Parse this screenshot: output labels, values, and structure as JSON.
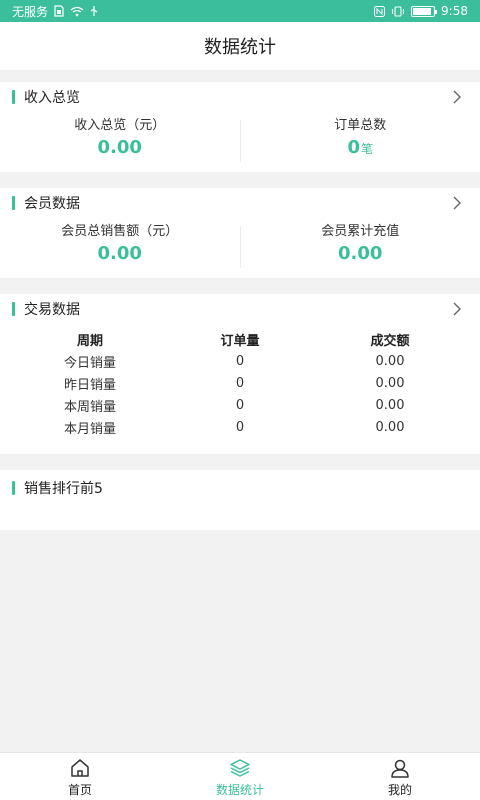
{
  "status": {
    "carrier": "无服务",
    "time": "9:58",
    "battery_level": 0.9,
    "icons": [
      "sim-icon",
      "wifi-icon",
      "usb-icon",
      "nfc-icon",
      "vibrate-icon",
      "battery-icon"
    ],
    "accent": "#3bbf9a"
  },
  "header": {
    "title": "数据统计"
  },
  "income": {
    "title": "收入总览",
    "metrics": [
      {
        "label": "收入总览（元）",
        "value": "0.00",
        "unit": ""
      },
      {
        "label": "订单总数",
        "value": "0",
        "unit": "笔"
      }
    ]
  },
  "member": {
    "title": "会员数据",
    "metrics": [
      {
        "label": "会员总销售额（元）",
        "value": "0.00"
      },
      {
        "label": "会员累计充值",
        "value": "0.00"
      }
    ]
  },
  "trade": {
    "title": "交易数据",
    "columns": [
      "周期",
      "订单量",
      "成交额"
    ],
    "rows": [
      [
        "今日销量",
        "0",
        "0.00"
      ],
      [
        "昨日销量",
        "0",
        "0.00"
      ],
      [
        "本周销量",
        "0",
        "0.00"
      ],
      [
        "本月销量",
        "0",
        "0.00"
      ]
    ]
  },
  "ranking": {
    "title": "销售排行前5"
  },
  "nav": {
    "items": [
      {
        "label": "首页",
        "icon": "home-icon",
        "active": false
      },
      {
        "label": "数据统计",
        "icon": "layers-icon",
        "active": true
      },
      {
        "label": "我的",
        "icon": "user-icon",
        "active": false
      }
    ]
  }
}
